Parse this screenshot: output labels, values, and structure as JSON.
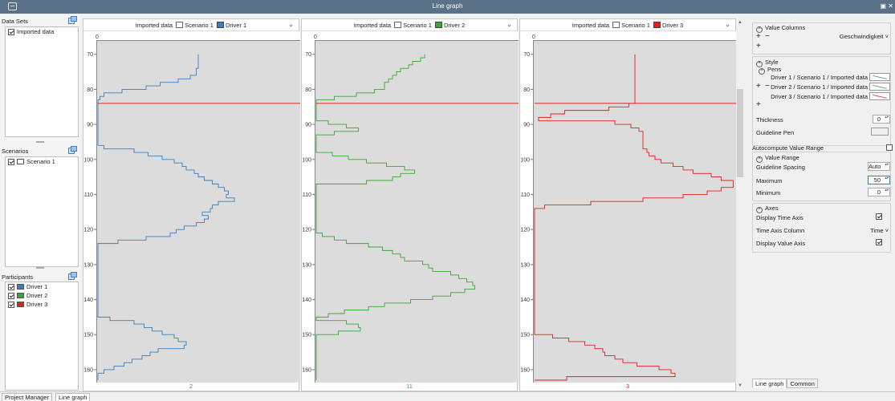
{
  "window": {
    "title": "Line graph"
  },
  "left_panel": {
    "datasets": {
      "title": "Data Sets",
      "items": [
        {
          "label": "Imported data",
          "checked": true
        }
      ]
    },
    "scenarios": {
      "title": "Scenarios",
      "items": [
        {
          "label": "Scenario 1",
          "checked": true
        }
      ]
    },
    "participants": {
      "title": "Participants",
      "items": [
        {
          "label": "Driver 1",
          "checked": true,
          "color": "#3a7ebf"
        },
        {
          "label": "Driver 2",
          "checked": true,
          "color": "#3aa63a"
        },
        {
          "label": "Driver 3",
          "checked": true,
          "color": "#e02020"
        }
      ]
    }
  },
  "charts": [
    {
      "dataset": "Imported data",
      "scenario": "Scenario 1",
      "driver": "Driver 1",
      "color": "#3a7ebf",
      "footer": "2"
    },
    {
      "dataset": "Imported data",
      "scenario": "Scenario 1",
      "driver": "Driver 2",
      "color": "#3aa63a",
      "footer": "11"
    },
    {
      "dataset": "Imported data",
      "scenario": "Scenario 1",
      "driver": "Driver 3",
      "color": "#e02020",
      "footer": "3"
    }
  ],
  "chart_data": [
    {
      "type": "line",
      "orientation": "vertical-time",
      "series": [
        {
          "name": "Driver 1",
          "color": "#3a7ebf",
          "points": [
            [
              70,
              50
            ],
            [
              72,
              50
            ],
            [
              74,
              49
            ],
            [
              76,
              46
            ],
            [
              77,
              40
            ],
            [
              78,
              31
            ],
            [
              79,
              24
            ],
            [
              80,
              12
            ],
            [
              81,
              3
            ],
            [
              82,
              1
            ],
            [
              83,
              0
            ],
            [
              95,
              0
            ],
            [
              96,
              3
            ],
            [
              97,
              18
            ],
            [
              98,
              25
            ],
            [
              99,
              32
            ],
            [
              100,
              38
            ],
            [
              101,
              42
            ],
            [
              102,
              44
            ],
            [
              103,
              48
            ],
            [
              104,
              50
            ],
            [
              105,
              53
            ],
            [
              106,
              57
            ],
            [
              107,
              60
            ],
            [
              108,
              63
            ],
            [
              109,
              65
            ],
            [
              110,
              64
            ],
            [
              111,
              68
            ],
            [
              112,
              60
            ],
            [
              113,
              57
            ],
            [
              114,
              56
            ],
            [
              115,
              52
            ],
            [
              116,
              55
            ],
            [
              117,
              53
            ],
            [
              118,
              49
            ],
            [
              119,
              43
            ],
            [
              120,
              39
            ],
            [
              121,
              36
            ],
            [
              122,
              24
            ],
            [
              123,
              10
            ],
            [
              124,
              0
            ],
            [
              144,
              0
            ],
            [
              145,
              6
            ],
            [
              146,
              18
            ],
            [
              147,
              23
            ],
            [
              148,
              27
            ],
            [
              149,
              32
            ],
            [
              150,
              38
            ],
            [
              151,
              40
            ],
            [
              152,
              44
            ],
            [
              153,
              43
            ],
            [
              154,
              30
            ],
            [
              155,
              26
            ],
            [
              156,
              22
            ],
            [
              157,
              17
            ],
            [
              158,
              13
            ],
            [
              159,
              8
            ],
            [
              160,
              3
            ],
            [
              161,
              0
            ],
            [
              163,
              0
            ]
          ]
        }
      ],
      "vertical_marker": 84,
      "xlim": [
        0,
        100
      ],
      "ylim": [
        68,
        163
      ],
      "yticks": [
        "70",
        "80",
        "90",
        "100",
        "110",
        "120",
        "130",
        "140",
        "150",
        "160"
      ],
      "xtick": "0"
    },
    {
      "type": "line",
      "orientation": "vertical-time",
      "series": [
        {
          "name": "Driver 2",
          "color": "#3aa63a",
          "points": [
            [
              70,
              54
            ],
            [
              71,
              52
            ],
            [
              72,
              48
            ],
            [
              73,
              46
            ],
            [
              74,
              42
            ],
            [
              75,
              40
            ],
            [
              76,
              38
            ],
            [
              77,
              36
            ],
            [
              78,
              34
            ],
            [
              79,
              34
            ],
            [
              80,
              29
            ],
            [
              81,
              20
            ],
            [
              82,
              9
            ],
            [
              83,
              0
            ],
            [
              88,
              0
            ],
            [
              89,
              6
            ],
            [
              90,
              15
            ],
            [
              91,
              21
            ],
            [
              92,
              9
            ],
            [
              93,
              0
            ],
            [
              97,
              0
            ],
            [
              98,
              8
            ],
            [
              99,
              16
            ],
            [
              100,
              25
            ],
            [
              101,
              35
            ],
            [
              102,
              44
            ],
            [
              103,
              49
            ],
            [
              104,
              42
            ],
            [
              105,
              38
            ],
            [
              106,
              25
            ],
            [
              107,
              0
            ],
            [
              120,
              0
            ],
            [
              121,
              3
            ],
            [
              122,
              9
            ],
            [
              123,
              15
            ],
            [
              124,
              26
            ],
            [
              125,
              33
            ],
            [
              126,
              38
            ],
            [
              127,
              42
            ],
            [
              128,
              44
            ],
            [
              129,
              53
            ],
            [
              130,
              56
            ],
            [
              131,
              58
            ],
            [
              132,
              67
            ],
            [
              133,
              71
            ],
            [
              134,
              75
            ],
            [
              135,
              78
            ],
            [
              136,
              79
            ],
            [
              137,
              74
            ],
            [
              138,
              67
            ],
            [
              139,
              58
            ],
            [
              140,
              47
            ],
            [
              141,
              34
            ],
            [
              142,
              26
            ],
            [
              143,
              14
            ],
            [
              144,
              6
            ],
            [
              145,
              0
            ],
            [
              146,
              15
            ],
            [
              147,
              21
            ],
            [
              148,
              22
            ],
            [
              149,
              11
            ],
            [
              150,
              0
            ],
            [
              163,
              0
            ]
          ]
        }
      ],
      "vertical_marker": 84,
      "xlim": [
        0,
        100
      ],
      "ylim": [
        68,
        163
      ],
      "yticks": [
        "70",
        "80",
        "90",
        "100",
        "110",
        "120",
        "130",
        "140",
        "150",
        "160"
      ],
      "xtick": "0"
    },
    {
      "type": "line",
      "orientation": "vertical-time",
      "series": [
        {
          "name": "Driver 3",
          "color": "#e02020",
          "points": [
            [
              70,
              50
            ],
            [
              77,
              50
            ],
            [
              82,
              50
            ],
            [
              84,
              47
            ],
            [
              85,
              37
            ],
            [
              86,
              15
            ],
            [
              87,
              8
            ],
            [
              88,
              2
            ],
            [
              89,
              40
            ],
            [
              90,
              48
            ],
            [
              91,
              52
            ],
            [
              92,
              54
            ],
            [
              95,
              54
            ],
            [
              97,
              56
            ],
            [
              98,
              57
            ],
            [
              99,
              60
            ],
            [
              100,
              63
            ],
            [
              101,
              69
            ],
            [
              102,
              74
            ],
            [
              103,
              79
            ],
            [
              104,
              88
            ],
            [
              105,
              93
            ],
            [
              106,
              99
            ],
            [
              107,
              99
            ],
            [
              108,
              93
            ],
            [
              109,
              86
            ],
            [
              110,
              74
            ],
            [
              111,
              54
            ],
            [
              112,
              28
            ],
            [
              113,
              5
            ],
            [
              114,
              0
            ],
            [
              149,
              0
            ],
            [
              150,
              9
            ],
            [
              151,
              17
            ],
            [
              152,
              25
            ],
            [
              153,
              30
            ],
            [
              154,
              34
            ],
            [
              155,
              35
            ],
            [
              156,
              40
            ],
            [
              157,
              44
            ],
            [
              158,
              51
            ],
            [
              159,
              62
            ],
            [
              160,
              68
            ],
            [
              161,
              70
            ],
            [
              162,
              16
            ],
            [
              163,
              0
            ]
          ]
        }
      ],
      "vertical_marker": 84,
      "xlim": [
        0,
        100
      ],
      "ylim": [
        68,
        163
      ],
      "yticks": [
        "70",
        "80",
        "90",
        "100",
        "110",
        "120",
        "130",
        "140",
        "150",
        "160"
      ],
      "xtick": "0"
    }
  ],
  "right_panel": {
    "value_columns": {
      "title": "Value Columns",
      "plus": "+",
      "minus": "−",
      "plus2": "+",
      "selected": "Geschwindigkeit"
    },
    "style": {
      "title": "Style",
      "pens_title": "Pens",
      "pens": [
        {
          "label": "Driver 1 / Scenario 1 / Imported data",
          "color": "#3a7ebf"
        },
        {
          "label": "Driver 2 / Scenario 1 / Imported data",
          "color": "#3aa63a"
        },
        {
          "label": "Driver 3 / Scenario 1 / Imported data",
          "color": "#e02020"
        }
      ],
      "pen_plus": "+",
      "pen_minus": "−",
      "pen_add": "+",
      "thickness_label": "Thickness",
      "thickness_value": "0",
      "guideline_pen_label": "Guideline Pen"
    },
    "autocompute_label": "Autocompute Value Range",
    "value_range": {
      "title": "Value Range",
      "guideline_spacing_label": "Guideline Spacing",
      "guideline_spacing_value": "Auto",
      "maximum_label": "Maximum",
      "maximum_value": "50",
      "minimum_label": "Minimum",
      "minimum_value": "0"
    },
    "axes": {
      "title": "Axes",
      "display_time_axis_label": "Display Time Axis",
      "time_axis_column_label": "Time Axis Column",
      "time_axis_column_value": "Time",
      "display_value_axis_label": "Display Value Axis"
    },
    "tabs": [
      "Line graph",
      "Common"
    ]
  },
  "bottom_tabs": [
    "Project Manager",
    "Line graph"
  ]
}
